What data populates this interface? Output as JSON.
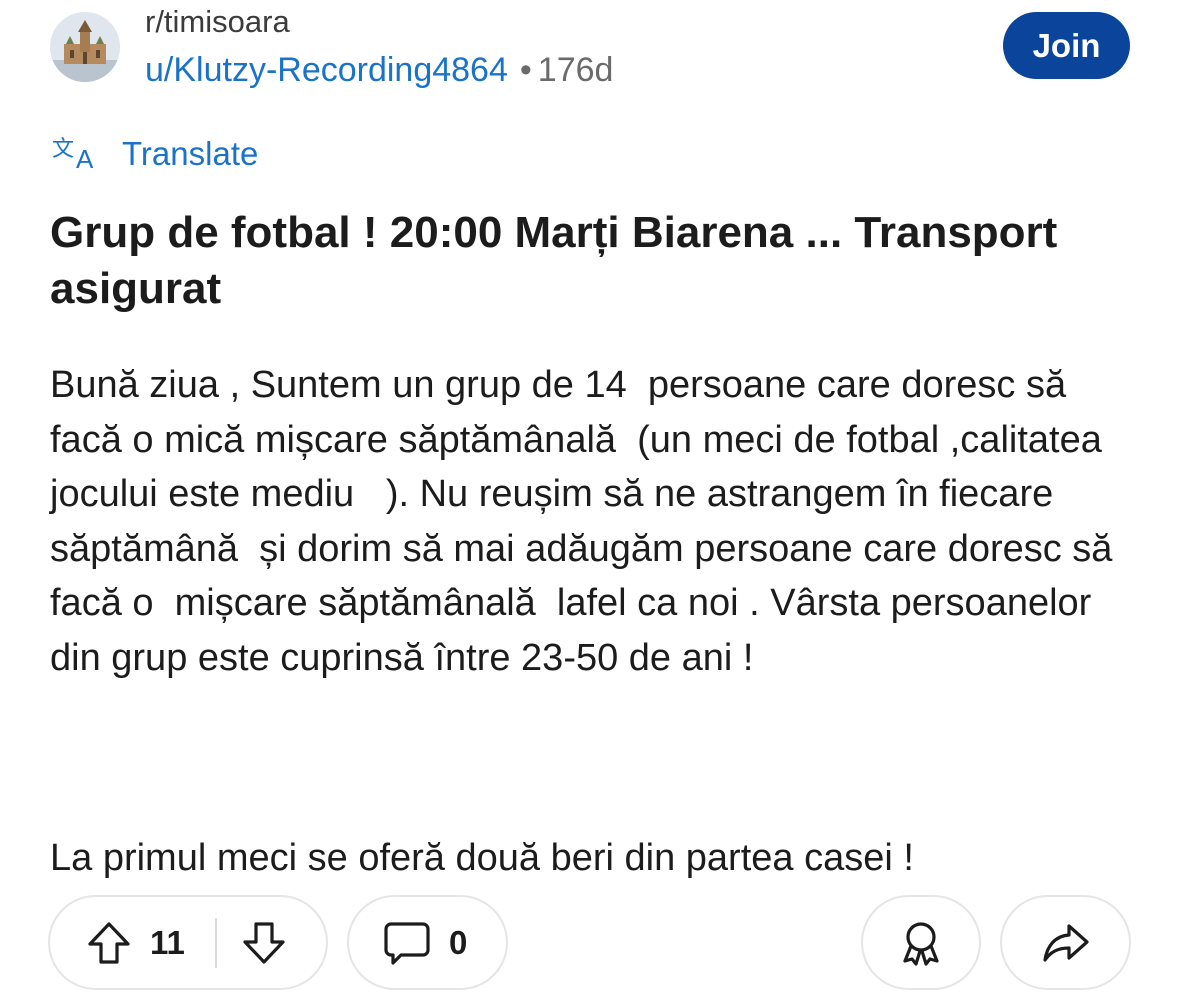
{
  "header": {
    "subreddit": "r/timisoara",
    "author": "u/Klutzy-Recording4864",
    "separator": "•",
    "age": "176d",
    "join_label": "Join"
  },
  "translate": {
    "label": "Translate",
    "icon": "translate-icon"
  },
  "post": {
    "title": "Grup de fotbal ! 20:00 Marți  Biarena ... Transport asigurat",
    "body_paragraph_1": "Bună ziua , Suntem un grup de 14  persoane care doresc să facă o mică mișcare săptămânală  (un meci de fotbal ,calitatea jocului este mediu   ). Nu reușim să ne astrangem în fiecare săptămână  și dorim să mai adăugăm persoane care doresc să facă o  mișcare săptămânală  lafel ca noi . Vârsta persoanelor din grup este cuprinsă între 23-50 de ani !",
    "body_paragraph_2": "La primul meci se oferă două beri din partea casei !"
  },
  "actions": {
    "upvote_count": "11",
    "comment_count": "0",
    "icons": [
      "upvote-icon",
      "downvote-icon",
      "comment-icon",
      "award-icon",
      "share-icon"
    ]
  },
  "colors": {
    "join_bg": "#0a449b",
    "link": "#1a73c8",
    "text": "#1c1c1c",
    "muted": "#6b6b6b",
    "pill_border": "#e3e5e8"
  }
}
